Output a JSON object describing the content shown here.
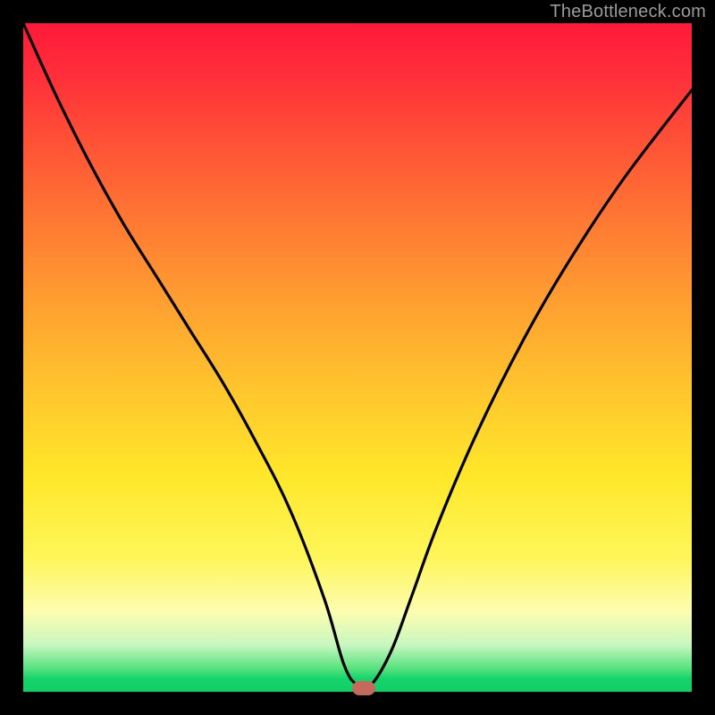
{
  "watermark": "TheBottleneck.com",
  "chart_data": {
    "type": "line",
    "title": "",
    "xlabel": "",
    "ylabel": "",
    "xlim": [
      0,
      100
    ],
    "ylim": [
      0,
      100
    ],
    "grid": false,
    "series": [
      {
        "name": "bottleneck-curve",
        "x": [
          0,
          5,
          10,
          15,
          20,
          25,
          30,
          35,
          40,
          45,
          48,
          50,
          52,
          55,
          58,
          62,
          68,
          75,
          82,
          90,
          100
        ],
        "values": [
          100,
          89,
          79,
          70,
          62,
          54,
          46,
          37,
          27,
          14,
          4,
          1,
          1,
          6,
          14,
          25,
          39,
          53,
          65,
          77,
          90
        ]
      }
    ],
    "annotations": [
      {
        "name": "current-config-marker",
        "x": 51,
        "y": 0.5
      }
    ],
    "background_gradient": {
      "top": "#ff1a3a",
      "mid": "#ffe82a",
      "bottom": "#0fcf67"
    }
  }
}
